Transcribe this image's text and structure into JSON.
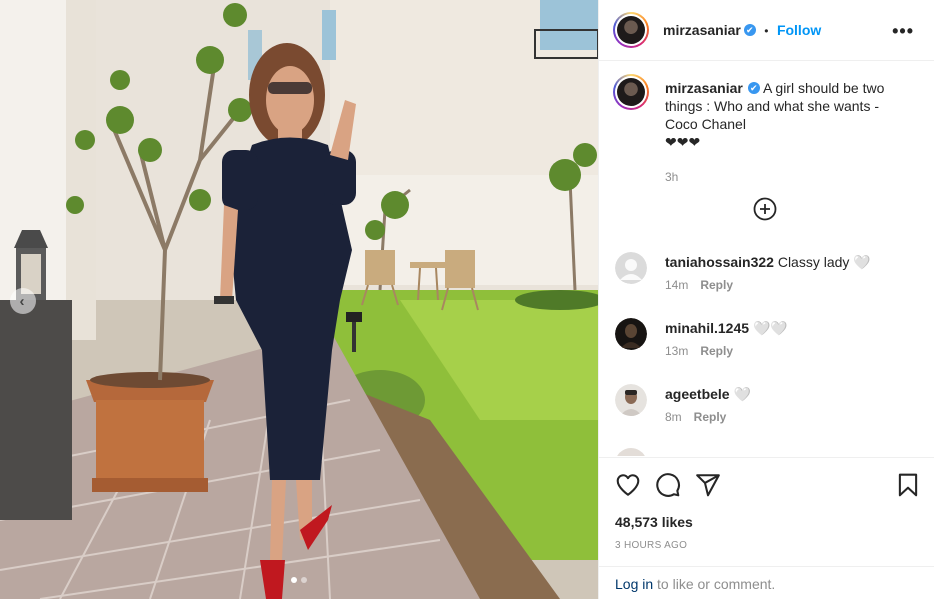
{
  "post": {
    "username": "mirzasaniar",
    "follow_label": "Follow",
    "separator": "•",
    "more_label": "•••",
    "verified_mark": "✔",
    "caption": "A girl should be two things : Who and what she wants - Coco Chanel",
    "caption_emoji": "❤❤❤",
    "caption_time": "3h",
    "likes": "48,573 likes",
    "posted_ago": "3 HOURS AGO",
    "login_link": "Log in",
    "login_suffix": "to like or comment.",
    "carousel_prev": "‹"
  },
  "comments": [
    {
      "user": "taniahossain322",
      "text": "Classy lady 🤍",
      "time": "14m",
      "reply": "Reply",
      "avatar": "default-avatar"
    },
    {
      "user": "minahil.1245",
      "text": "🤍🤍",
      "time": "13m",
      "reply": "Reply",
      "avatar": "dark-avatar"
    },
    {
      "user": "ageetbele",
      "text": "🤍",
      "time": "8m",
      "reply": "Reply",
      "avatar": "man-avatar"
    }
  ],
  "icons": {
    "like": "heart-icon",
    "comment": "comment-icon",
    "share": "share-icon",
    "save": "bookmark-icon",
    "load_more": "plus-circle-icon",
    "more": "more-icon"
  },
  "colors": {
    "accent": "#0095f6",
    "verified": "#3897f0",
    "text": "#262626",
    "muted": "#8e8e8e",
    "border": "#efefef"
  }
}
